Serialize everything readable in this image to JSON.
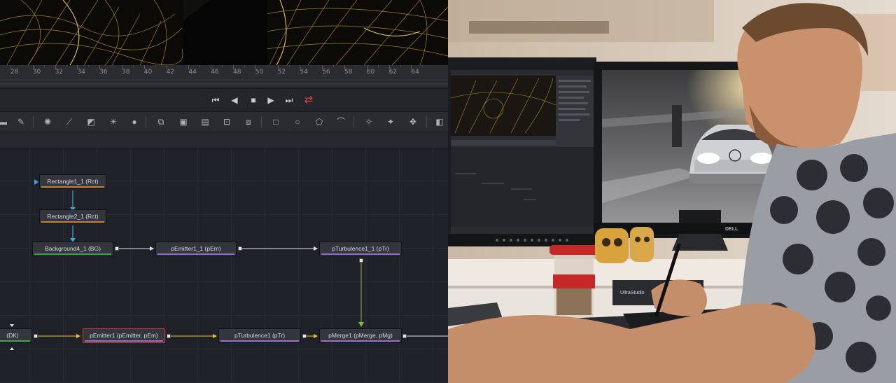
{
  "ruler": {
    "labels": [
      "28",
      "30",
      "32",
      "34",
      "36",
      "38",
      "40",
      "42",
      "44",
      "46",
      "48",
      "50",
      "52",
      "54",
      "56",
      "58",
      "60",
      "62",
      "64"
    ]
  },
  "transport": {
    "skip_back": "⏮",
    "play_reverse": "◀",
    "stop": "■",
    "play": "▶",
    "skip_forward": "⏭",
    "loop": "⇄"
  },
  "nodes": {
    "rectangle1_1": "Rectangle1_1  (Rct)",
    "rectangle2_1": "Rectangle2_1  (Rct)",
    "background4_1": "Background4_1  (BG)",
    "pemitter1_1": "pEmitter1_1  (pEm)",
    "pturbulence1_1": "pTurbulence1_1  (pTr)",
    "dk": "(DK)",
    "pemitter1": "pEmitter1  (pEmitter, pEm)",
    "pturbulence1": "pTurbulence1  (pTr)",
    "pmerge1": "pMerge1  (pMerge, pMg)"
  },
  "photo": {
    "device_label": "UltraStudio",
    "monitor_brand": "DELL"
  },
  "colors": {
    "accent_loop": "#e04040",
    "band_mask": "#c87a2a",
    "band_bg": "#3fa04a",
    "band_particle": "#9a6cc4",
    "wire_main": "#e8c020",
    "wire_white": "#e0e0e0",
    "wire_green": "#7fb840",
    "wire_mask": "#38a8d8"
  }
}
